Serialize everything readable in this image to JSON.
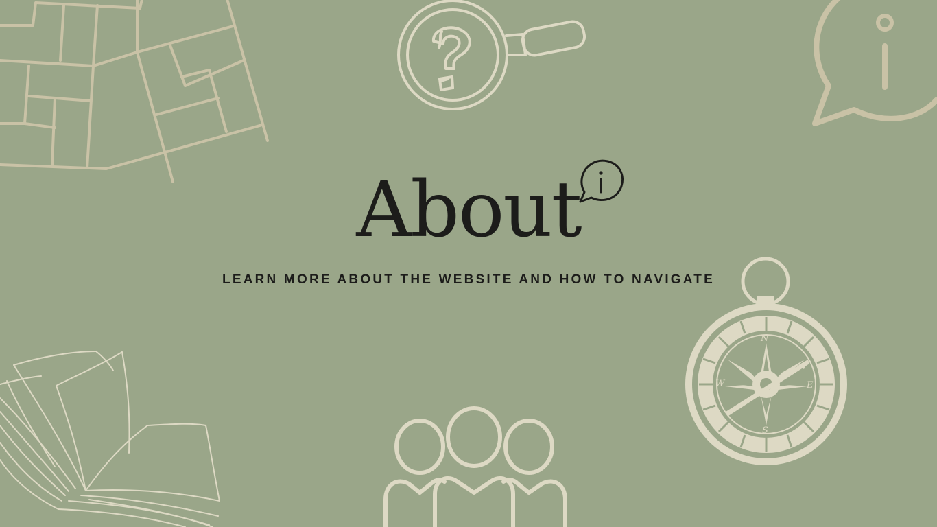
{
  "page": {
    "title": "About",
    "subtitle": "LEARN MORE ABOUT THE WEBSITE AND HOW TO NAVIGATE"
  },
  "colors": {
    "background": "#9aa689",
    "text": "#1c1c1a",
    "decoration_light": "#ddd9c4",
    "decoration_tan": "#c9c2a6"
  },
  "compass": {
    "letters": {
      "north": "N",
      "south": "S",
      "east": "E",
      "west": "W"
    }
  },
  "decorations": [
    "map-icon",
    "magnifying-question-icon",
    "info-bubble-icon",
    "open-book-icon",
    "people-group-icon",
    "compass-icon",
    "title-info-bubble-icon"
  ]
}
